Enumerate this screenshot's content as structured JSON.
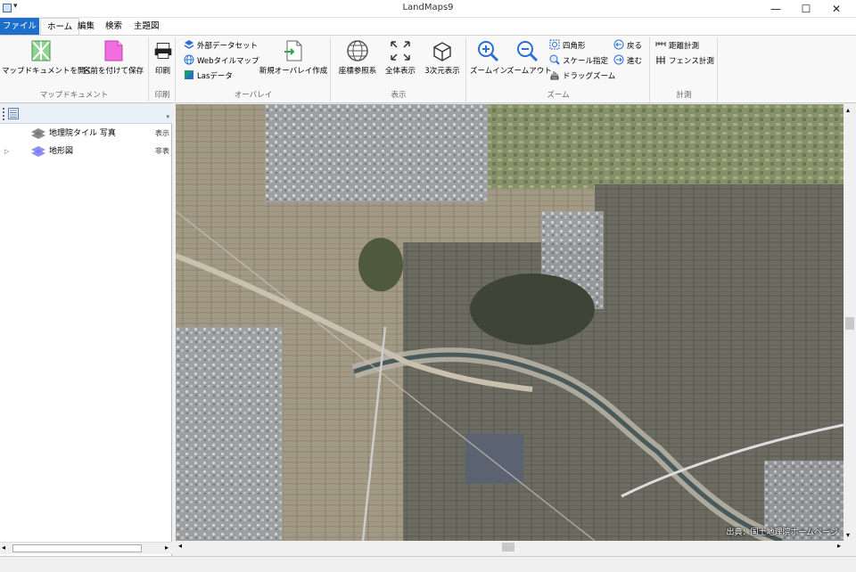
{
  "window": {
    "title": "LandMaps9",
    "quick_access": "▾"
  },
  "window_buttons": {
    "minimize": "—",
    "maximize": "☐",
    "close": "✕"
  },
  "tabs": [
    {
      "label": "ファイル"
    },
    {
      "label": "ホーム"
    },
    {
      "label": "編集"
    },
    {
      "label": "検索"
    },
    {
      "label": "主題図"
    }
  ],
  "ribbon": {
    "map_document": {
      "label": "マップドキュメント",
      "open": "マップドキュメントを開く",
      "save_as": "名前を付けて保存"
    },
    "print": {
      "label": "印刷",
      "print": "印刷"
    },
    "overlay": {
      "label": "オーバレイ",
      "external_dataset": "外部データセット",
      "web_tile_map": "Webタイルマップ",
      "las_data": "Lasデータ",
      "new_overlay": "新規オーバレイ作成"
    },
    "display": {
      "label": "表示",
      "coord_ref": "座標参照系",
      "full_extent": "全体表示",
      "view_3d": "3次元表示"
    },
    "zoom": {
      "label": "ズーム",
      "zoom_in": "ズームイン",
      "zoom_out": "ズームアウト",
      "rectangle": "四角形",
      "scale": "スケール指定",
      "drag_zoom": "ドラッグズーム",
      "back": "戻る",
      "forward": "進む"
    },
    "measure": {
      "label": "計測",
      "distance": "距離計測",
      "fence": "フェンス計測"
    }
  },
  "layers": [
    {
      "name": "地理院タイル 写真",
      "state": "表示"
    },
    {
      "name": "地形図",
      "state": "非表"
    }
  ],
  "map": {
    "credit": "出典：国土地理院ホームページ"
  },
  "colors": {
    "accent": "#1e6fc9",
    "layer_icon": "#7a7af0"
  }
}
